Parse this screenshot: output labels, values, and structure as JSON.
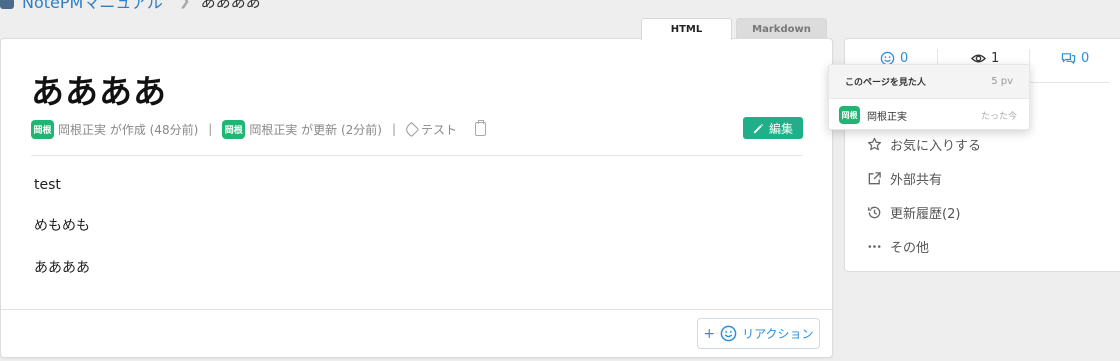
{
  "breadcrumb": {
    "root": "NotePMマニュアル",
    "current": "ああああ"
  },
  "view_tabs": [
    {
      "label": "HTML",
      "active": true
    },
    {
      "label": "Markdown",
      "active": false
    }
  ],
  "page": {
    "title": "ああああ",
    "meta": {
      "author_badge": "岡根",
      "created_by": "岡根正実 が作成 (48分前)",
      "updater_badge": "岡根",
      "updated_by": "岡根正実 が更新 (2分前)",
      "tag": "テスト"
    },
    "edit_label": "編集",
    "body": [
      "test",
      "めもめも",
      "ああああ"
    ],
    "reaction_label": "リアクション",
    "reaction_plus": "+"
  },
  "sidebar": {
    "stats": {
      "reactions": "0",
      "views": "1",
      "comments": "0"
    },
    "actions": [
      {
        "label": "お気に入りする",
        "icon": "star-icon"
      },
      {
        "label": "外部共有",
        "icon": "external-link-icon"
      },
      {
        "label": "更新履歴(2)",
        "icon": "history-icon"
      },
      {
        "label": "その他",
        "icon": "more-icon"
      }
    ]
  },
  "viewers_popup": {
    "title": "このページを見た人",
    "pv": "5 pv",
    "viewers": [
      {
        "badge": "岡根",
        "name": "岡根正実",
        "when": "たった今"
      }
    ]
  },
  "colors": {
    "accent_blue": "#2d8fd6",
    "badge_green": "#1fb673",
    "edit_green": "#1fb08a"
  }
}
